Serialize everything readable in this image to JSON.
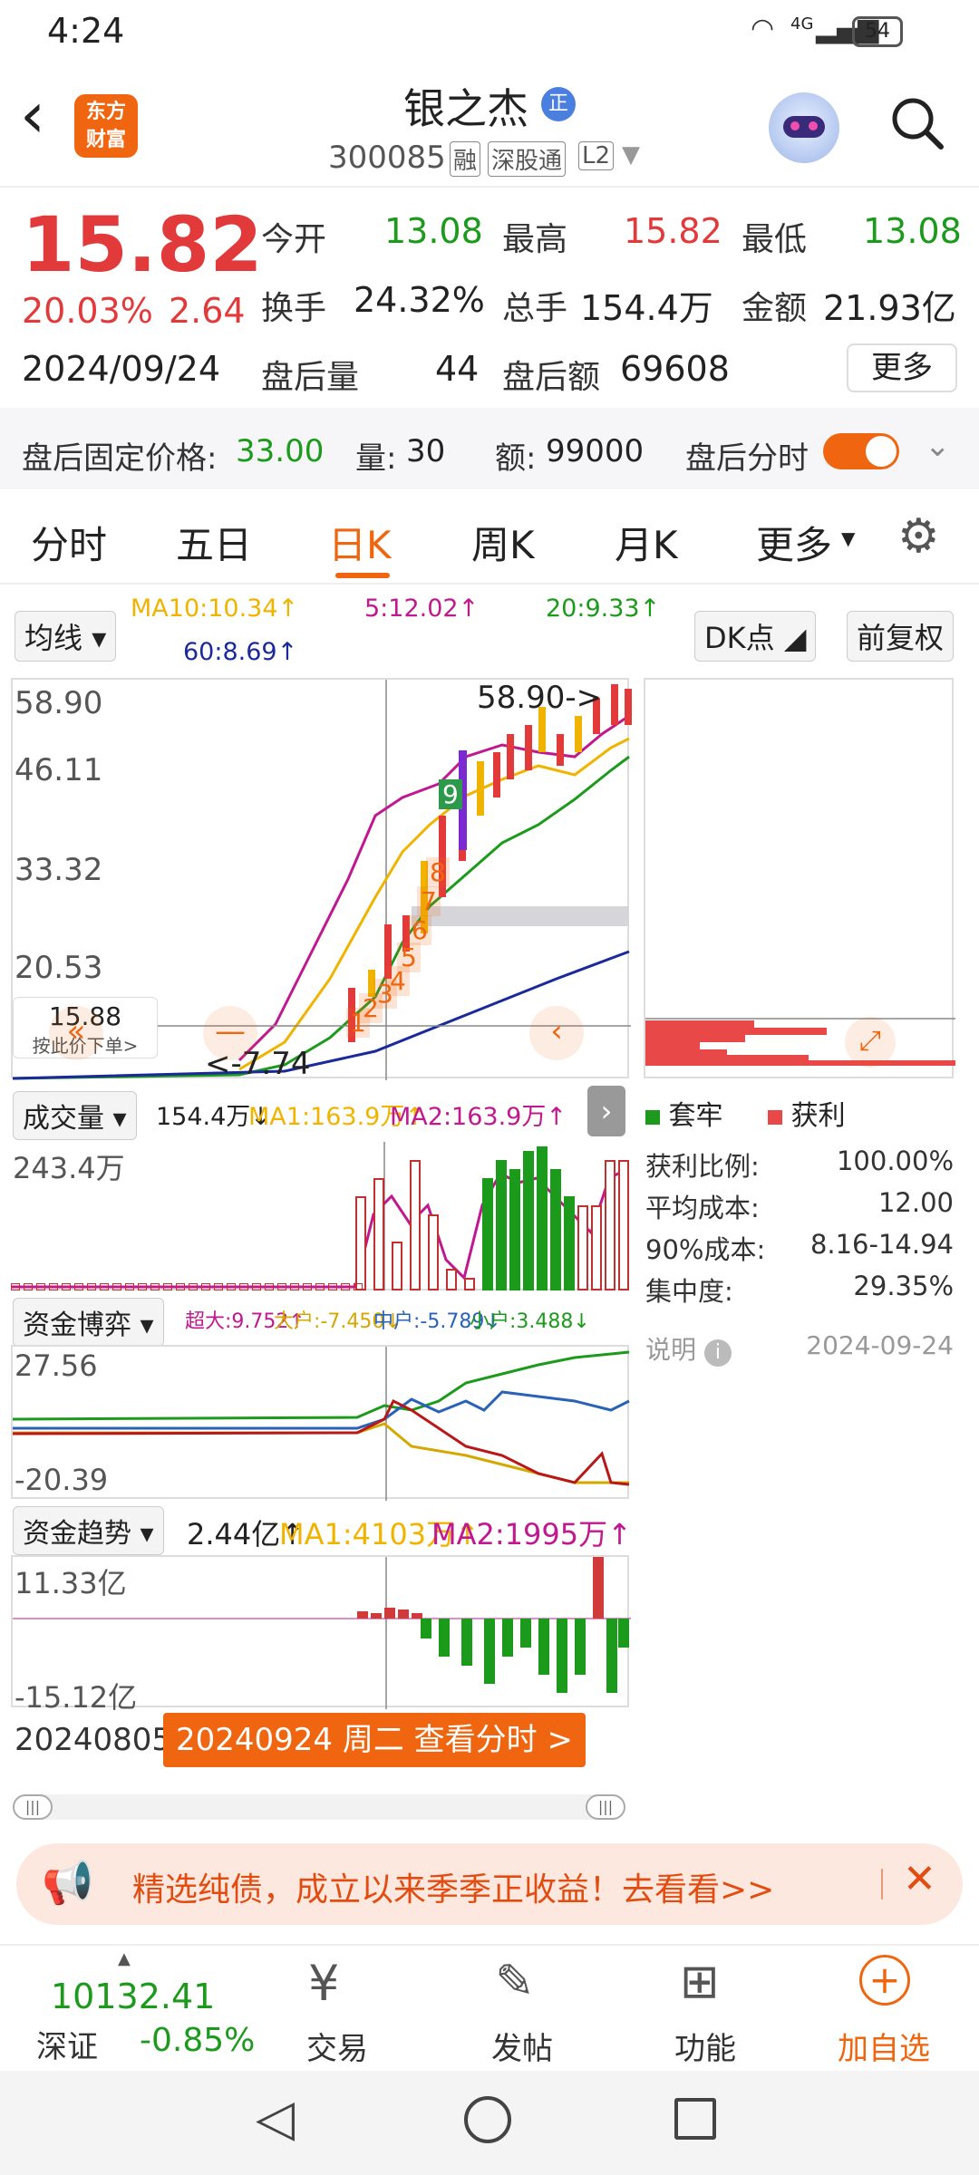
{
  "status": {
    "time": "4:24",
    "battery": "54",
    "net": "4G"
  },
  "header": {
    "title": "银之杰",
    "badge": "正",
    "code": "300085",
    "tags": [
      "融",
      "深股通",
      "L2"
    ],
    "logo_line1": "东方",
    "logo_line2": "财富"
  },
  "quote": {
    "price": "15.82",
    "change_pct": "20.03%",
    "change": "2.64",
    "date": "2024/09/24",
    "open_label": "今开",
    "open": "13.08",
    "high_label": "最高",
    "high": "15.82",
    "low_label": "最低",
    "low": "13.08",
    "turnover_label": "换手",
    "turnover": "24.32%",
    "vol_label": "总手",
    "vol": "154.4万",
    "amount_label": "金额",
    "amount": "21.93亿",
    "after_vol_label": "盘后量",
    "after_vol": "44",
    "after_amt_label": "盘后额",
    "after_amt": "69608",
    "more": "更多"
  },
  "afterhours": {
    "price_label": "盘后固定价格:",
    "price": "33.00",
    "vol_label": "量:",
    "vol": "30",
    "amt_label": "额:",
    "amt": "99000",
    "toggle_label": "盘后分时"
  },
  "tabs": [
    "分时",
    "五日",
    "日K",
    "周K",
    "月K",
    "更多"
  ],
  "kline": {
    "ma_select": "均线",
    "ma10": "MA10:10.34↑",
    "ma5": "5:12.02↑",
    "ma20": "20:9.33↑",
    "ma60": "60:8.69↑",
    "dk": "DK点",
    "fq": "前复权",
    "y_labels": [
      "58.90",
      "46.11",
      "33.32",
      "20.53"
    ],
    "max_label": "58.90->",
    "min_label": "<-7.74",
    "cross_price": "15.88",
    "cross_hint": "按此价下单>",
    "counts": [
      "1",
      "2",
      "3",
      "4",
      "5",
      "6",
      "7",
      "8",
      "9"
    ]
  },
  "chip": {
    "legend_trap": "套牢",
    "legend_profit": "获利",
    "rows": [
      {
        "k": "获利比例:",
        "v": "100.00%"
      },
      {
        "k": "平均成本:",
        "v": "12.00"
      },
      {
        "k": "90%成本:",
        "v": "8.16-14.94"
      },
      {
        "k": "集中度:",
        "v": "29.35%"
      }
    ],
    "note": "说明",
    "date": "2024-09-24"
  },
  "volume": {
    "select": "成交量",
    "vol": "154.4万↓",
    "ma1": "MA1:163.9万↑",
    "ma2": "MA2:163.9万↑",
    "ymax": "243.4万"
  },
  "fund_game": {
    "select": "资金博弈",
    "super": "超大:9.752↑",
    "big": "大户:-7.450↓",
    "mid": "中户:-5.789↓",
    "small": "小户:3.488↓",
    "ymax": "27.56",
    "ymin": "-20.39"
  },
  "fund_trend": {
    "select": "资金趋势",
    "val": "2.44亿↑",
    "ma1": "MA1:4103万↑",
    "ma2": "MA2:1995万↑",
    "ymax": "11.33亿",
    "ymin": "-15.12亿"
  },
  "timeline": {
    "start": "20240805",
    "cursor": "20240924 周二 查看分时 >"
  },
  "ad": {
    "text": "精选纯债，成立以来季季正收益！去看看>>"
  },
  "bottom": {
    "index_val": "10132.41",
    "index_name": "深证",
    "index_chg": "-0.85%",
    "trade": "交易",
    "post": "发帖",
    "func": "功能",
    "add": "加自选"
  },
  "colors": {
    "accent": "#f0650f",
    "up": "#e23a3a",
    "down": "#1c9a1c"
  }
}
